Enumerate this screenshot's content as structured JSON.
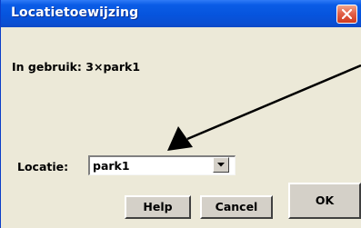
{
  "window": {
    "title": "Locatietoewijzing"
  },
  "content": {
    "in_use_text": "In gebruik: 3×park1",
    "location_label": "Locatie:",
    "location_value": "park1"
  },
  "buttons": {
    "help": "Help",
    "cancel": "Cancel",
    "ok": "OK"
  },
  "icons": {
    "close": "close-icon",
    "dropdown": "chevron-down-icon",
    "annotation": "arrow-annotation"
  },
  "colors": {
    "titlebar": "#0654dd",
    "close_button": "#e2624a",
    "dialog_background": "#ece9d8",
    "button_face": "#d4d0c8"
  }
}
